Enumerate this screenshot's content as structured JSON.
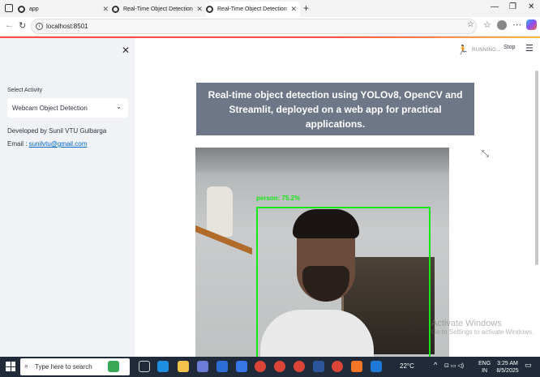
{
  "browser": {
    "tabs": [
      {
        "label": "app"
      },
      {
        "label": "Real-Time Object Detection"
      },
      {
        "label": "Real-Time Object Detection"
      }
    ],
    "url": "localhost:8501"
  },
  "sidebar": {
    "select_label": "Select Activity",
    "select_value": "Webcam Object Detection",
    "developer": "Developed by Sunil VTU Gulbarga",
    "email_label": "Email : ",
    "email": "sunilvtu@gmail.com"
  },
  "header": {
    "status": "RUNNING...",
    "stop_label": "Stop"
  },
  "main": {
    "banner": "Real-time object detection using YOLOv8, OpenCV and Streamlit, deployed on a web app for practical applications.",
    "detection_label": "person: 75.2%"
  },
  "watermark": {
    "line1": "Activate Windows",
    "line2": "Go to Settings to activate Windows."
  },
  "taskbar": {
    "search_placeholder": "Type here to search",
    "temperature": "22°C",
    "lang": "ENG",
    "region": "IN",
    "time": "3:25 AM",
    "date": "8/5/2025"
  },
  "colors": {
    "accent": "#ff4b4b",
    "banner_bg": "#6d7787",
    "bbox": "#17e817",
    "link": "#0068c9"
  }
}
